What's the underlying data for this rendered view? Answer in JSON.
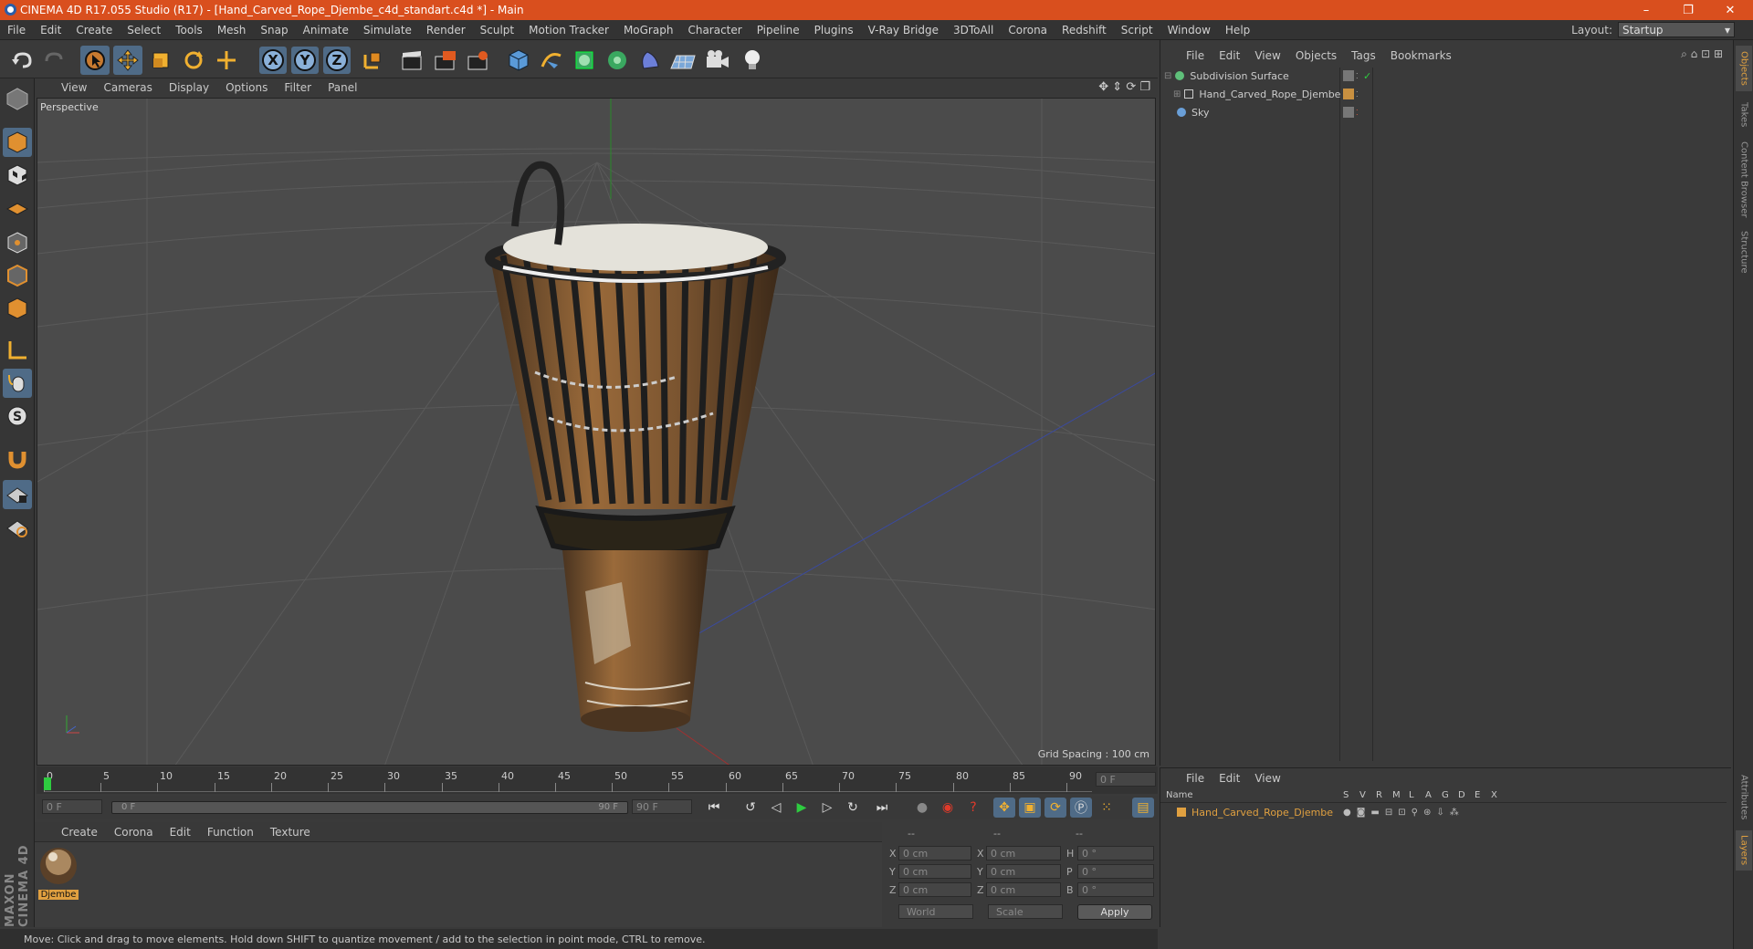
{
  "title": "CINEMA 4D R17.055 Studio (R17) - [Hand_Carved_Rope_Djembe_c4d_standart.c4d *] - Main",
  "window_controls": [
    "–",
    "❐",
    "✕"
  ],
  "menu": [
    "File",
    "Edit",
    "Create",
    "Select",
    "Tools",
    "Mesh",
    "Snap",
    "Animate",
    "Simulate",
    "Render",
    "Sculpt",
    "Motion Tracker",
    "MoGraph",
    "Character",
    "Pipeline",
    "Plugins",
    "V-Ray Bridge",
    "3DToAll",
    "Corona",
    "Redshift",
    "Script",
    "Window",
    "Help"
  ],
  "layout": {
    "label": "Layout:",
    "value": "Startup"
  },
  "axis_buttons": [
    "X",
    "Y",
    "Z"
  ],
  "viewport": {
    "menu": [
      "View",
      "Cameras",
      "Display",
      "Options",
      "Filter",
      "Panel"
    ],
    "label": "Perspective",
    "grid_spacing": "Grid Spacing : 100 cm"
  },
  "timeline": {
    "ticks": [
      "0",
      "5",
      "10",
      "15",
      "20",
      "25",
      "30",
      "35",
      "40",
      "45",
      "50",
      "55",
      "60",
      "65",
      "70",
      "75",
      "80",
      "85",
      "90"
    ],
    "current_frame": "0 F",
    "start": "0 F",
    "range_start": "0 F",
    "range_end": "90 F",
    "end": "90 F"
  },
  "material_manager": {
    "menu": [
      "Create",
      "Corona",
      "Edit",
      "Function",
      "Texture"
    ],
    "materials": [
      {
        "name": "Djembe"
      }
    ]
  },
  "coordinates": {
    "headers": [
      "--",
      "--",
      "--"
    ],
    "rows": [
      {
        "a": "X",
        "av": "0 cm",
        "b": "X",
        "bv": "0 cm",
        "c": "H",
        "cv": "0 °"
      },
      {
        "a": "Y",
        "av": "0 cm",
        "b": "Y",
        "bv": "0 cm",
        "c": "P",
        "cv": "0 °"
      },
      {
        "a": "Z",
        "av": "0 cm",
        "b": "Z",
        "bv": "0 cm",
        "c": "B",
        "cv": "0 °"
      }
    ],
    "mode1": "World",
    "mode2": "Scale",
    "apply": "Apply"
  },
  "status": "Move: Click and drag to move elements. Hold down SHIFT to quantize movement / add to the selection in point mode, CTRL to remove.",
  "object_manager": {
    "menu": [
      "File",
      "Edit",
      "View",
      "Objects",
      "Tags",
      "Bookmarks"
    ],
    "objects": [
      {
        "name": "Subdivision Surface",
        "color": "#5fc07a"
      },
      {
        "name": "Hand_Carved_Rope_Djembe",
        "color": "#e0a040"
      },
      {
        "name": "Sky",
        "color": "#6a9fd8"
      }
    ]
  },
  "layer_manager": {
    "menu": [
      "File",
      "Edit",
      "View"
    ],
    "columns": [
      "Name",
      "S",
      "V",
      "R",
      "M",
      "L",
      "A",
      "G",
      "D",
      "E",
      "X"
    ],
    "layers": [
      {
        "name": "Hand_Carved_Rope_Djembe",
        "color": "#e0a040"
      }
    ]
  },
  "right_tabs": [
    "Objects",
    "Takes",
    "Content Browser",
    "Structure",
    "Attributes",
    "Layers"
  ],
  "brand": "MAXON CINEMA 4D",
  "colors": {
    "titlebar": "#d94f1e",
    "active": "#4f6b87",
    "accent": "#e0a040"
  }
}
